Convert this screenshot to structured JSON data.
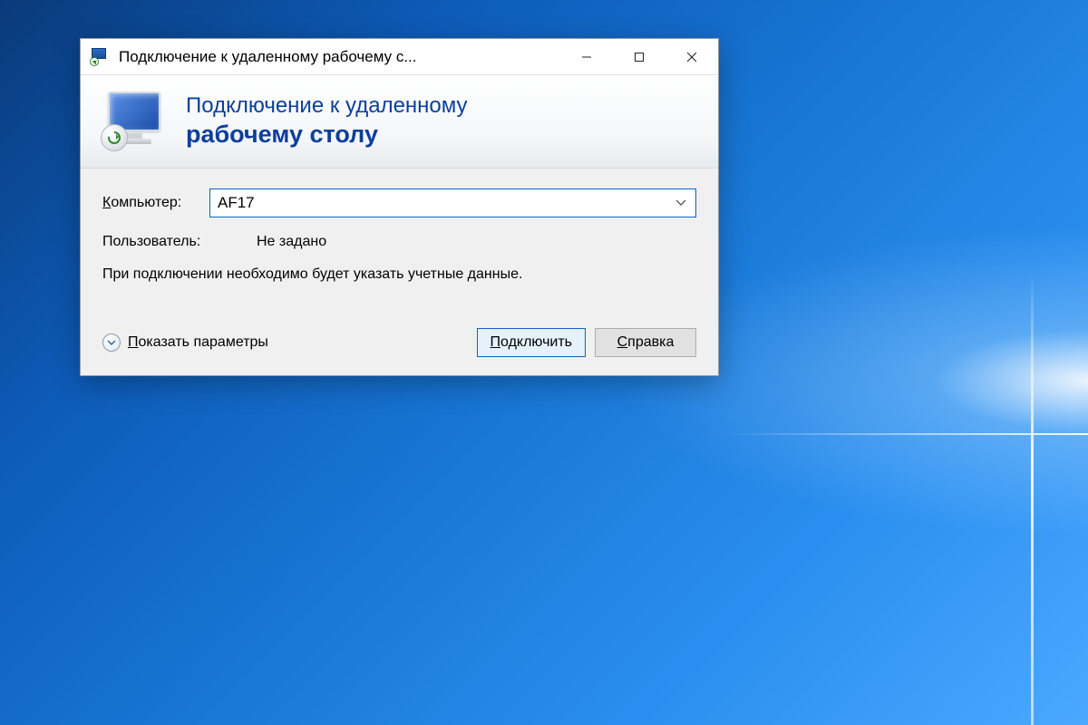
{
  "titlebar": {
    "title": "Подключение к удаленному рабочему с..."
  },
  "banner": {
    "line1": "Подключение к удаленному",
    "line2": "рабочему столу"
  },
  "form": {
    "computer_label_pre": "К",
    "computer_label_rest": "омпьютер:",
    "computer_value": "AF17",
    "user_label": "Пользователь:",
    "user_value": "Не задано",
    "hint": "При подключении необходимо будет указать учетные данные."
  },
  "footer": {
    "expand_pre": "П",
    "expand_rest": "оказать параметры",
    "connect_pre": "П",
    "connect_rest": "одключить",
    "help_pre": "С",
    "help_rest": "правка"
  }
}
